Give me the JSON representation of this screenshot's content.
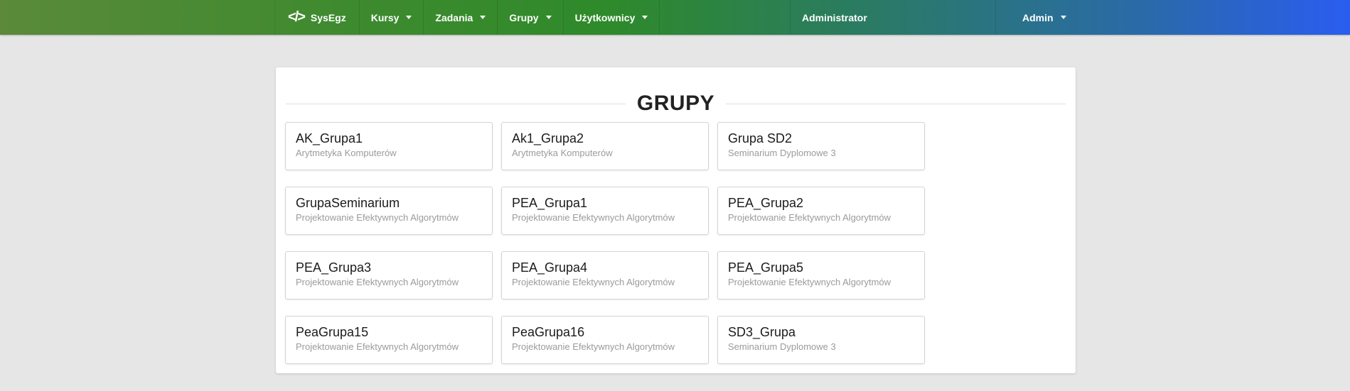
{
  "nav": {
    "brand": {
      "logo": "</>",
      "name": "SysEgz"
    },
    "items": [
      {
        "label": "Kursy"
      },
      {
        "label": "Zadania"
      },
      {
        "label": "Grupy"
      },
      {
        "label": "Użytkownicy"
      }
    ],
    "role_label": "Administrator",
    "user_label": "Admin"
  },
  "page": {
    "title": "GRUPY"
  },
  "groups": [
    {
      "name": "AK_Grupa1",
      "course": "Arytmetyka Komputerów"
    },
    {
      "name": "Ak1_Grupa2",
      "course": "Arytmetyka Komputerów"
    },
    {
      "name": "Grupa SD2",
      "course": "Seminarium Dyplomowe 3"
    },
    {
      "name": "GrupaSeminarium",
      "course": "Projektowanie Efektywnych Algorytmów"
    },
    {
      "name": "PEA_Grupa1",
      "course": "Projektowanie Efektywnych Algorytmów"
    },
    {
      "name": "PEA_Grupa2",
      "course": "Projektowanie Efektywnych Algorytmów"
    },
    {
      "name": "PEA_Grupa3",
      "course": "Projektowanie Efektywnych Algorytmów"
    },
    {
      "name": "PEA_Grupa4",
      "course": "Projektowanie Efektywnych Algorytmów"
    },
    {
      "name": "PEA_Grupa5",
      "course": "Projektowanie Efektywnych Algorytmów"
    },
    {
      "name": "PeaGrupa15",
      "course": "Projektowanie Efektywnych Algorytmów"
    },
    {
      "name": "PeaGrupa16",
      "course": "Projektowanie Efektywnych Algorytmów"
    },
    {
      "name": "SD3_Grupa",
      "course": "Seminarium Dyplomowe 3"
    }
  ]
}
